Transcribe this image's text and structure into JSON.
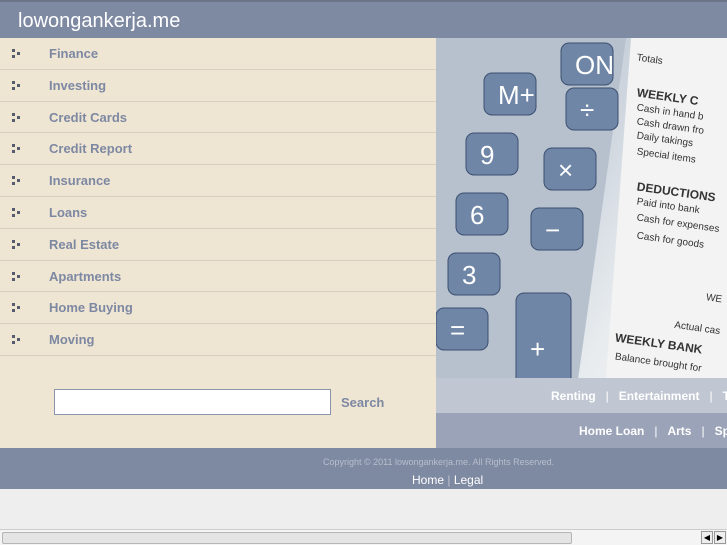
{
  "header": {
    "title": "lowongankerja.me"
  },
  "menu": {
    "items": [
      {
        "label": "Finance"
      },
      {
        "label": "Investing"
      },
      {
        "label": "Credit Cards"
      },
      {
        "label": "Credit Report"
      },
      {
        "label": "Insurance"
      },
      {
        "label": "Loans"
      },
      {
        "label": "Real Estate"
      },
      {
        "label": "Apartments"
      },
      {
        "label": "Home Buying"
      },
      {
        "label": "Moving"
      }
    ]
  },
  "search": {
    "value": "",
    "button": "Search"
  },
  "links_row1": [
    "Renting",
    "Entertainment",
    "Te"
  ],
  "links_row2": [
    "Home Loan",
    "Arts",
    "Sp"
  ],
  "footer": {
    "copyright": "Copyright © 2011 lowongankerja.me. All Rights Reserved.",
    "home": "Home",
    "legal": "Legal",
    "sep": "|"
  },
  "photo": {
    "keys": [
      "M+",
      "÷",
      "9",
      "×",
      "6",
      "−",
      "3",
      "+",
      "=",
      "ON"
    ],
    "paper": [
      "Totals",
      "WEEKLY C",
      "Cash in hand b",
      "Cash drawn fro",
      "Daily takings",
      "Special items",
      "DEDUCTIONS",
      "Paid into bank",
      "Cash for expenses",
      "Cash for goods",
      "WE",
      "Actual cas",
      "WEEKLY BANK",
      "Balance brought for"
    ]
  }
}
